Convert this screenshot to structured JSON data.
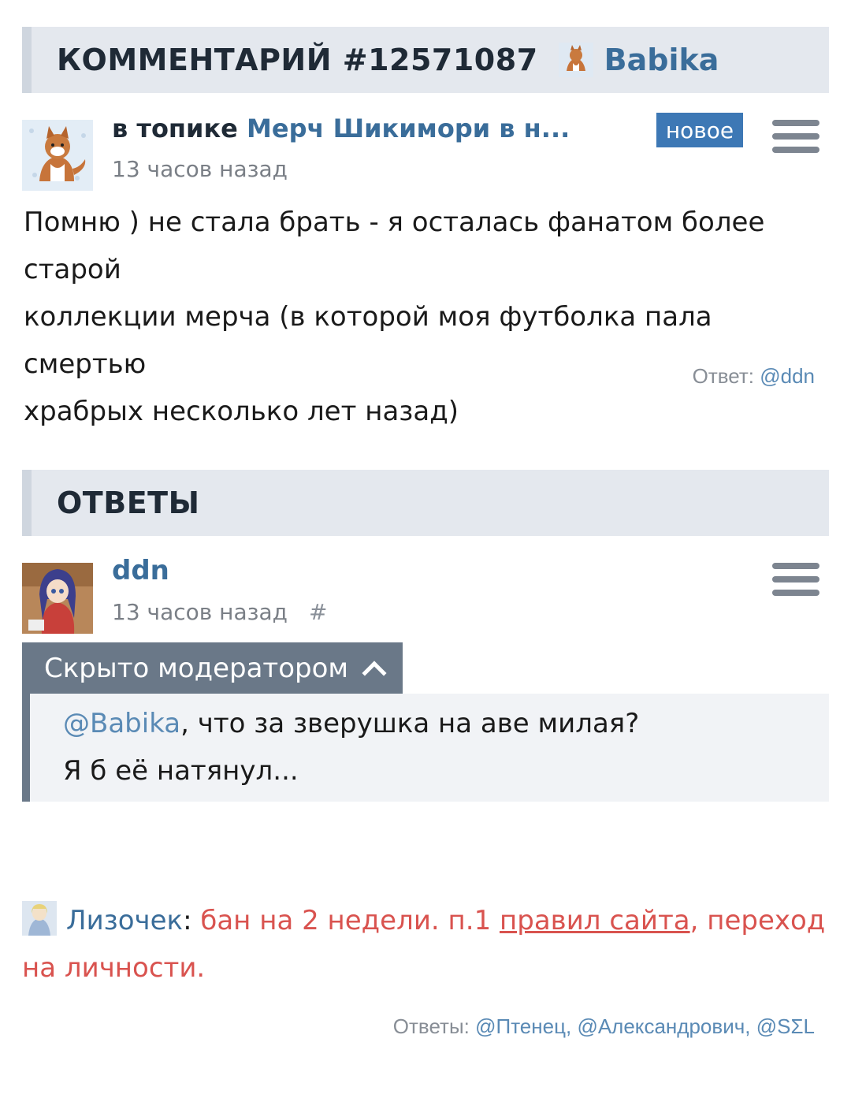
{
  "comment_header": {
    "title": "КОММЕНТАРИЙ #12571087",
    "author": "Babika"
  },
  "comment": {
    "topic_prefix": "в топике",
    "topic_title": "Мерч Шикимори в н...",
    "time": "13 часов назад",
    "badge": "новое",
    "text_line1": "Помню ) не стала брать - я осталась фанатом более старой",
    "text_line2": "коллекции мерча (в которой моя футболка пала смертью",
    "text_line3": "храбрых несколько лет назад)",
    "reply_label": "Ответ:",
    "reply_user": "@ddn"
  },
  "replies_header": {
    "title": "ОТВЕТЫ"
  },
  "reply": {
    "author": "ddn",
    "time": "13 часов назад",
    "hash": "#",
    "hidden_label": "Скрыто модератором",
    "mention": "@Babika",
    "text_line1_rest": ", что за зверушка на аве милая?",
    "text_line2": "Я б её натянул..."
  },
  "moderation": {
    "moderator": "Лизочек",
    "colon": ":",
    "ban_text": " бан на 2 недели. п.1 ",
    "rules_link": "правил сайта",
    "reason": ", переход на личности."
  },
  "replies_footer": {
    "label": "Ответы:",
    "user1": "@Птенец",
    "sep1": ", ",
    "user2": "@Александрович",
    "sep2": ", ",
    "user3": "@SΣL"
  },
  "colors": {
    "link": "#3a6d9a",
    "badge": "#3d78b5",
    "moderation": "#d9534f",
    "hidden_bar": "#6a7888"
  },
  "icons": {
    "menu": "hamburger-menu-icon",
    "chevron": "chevron-up-icon"
  }
}
